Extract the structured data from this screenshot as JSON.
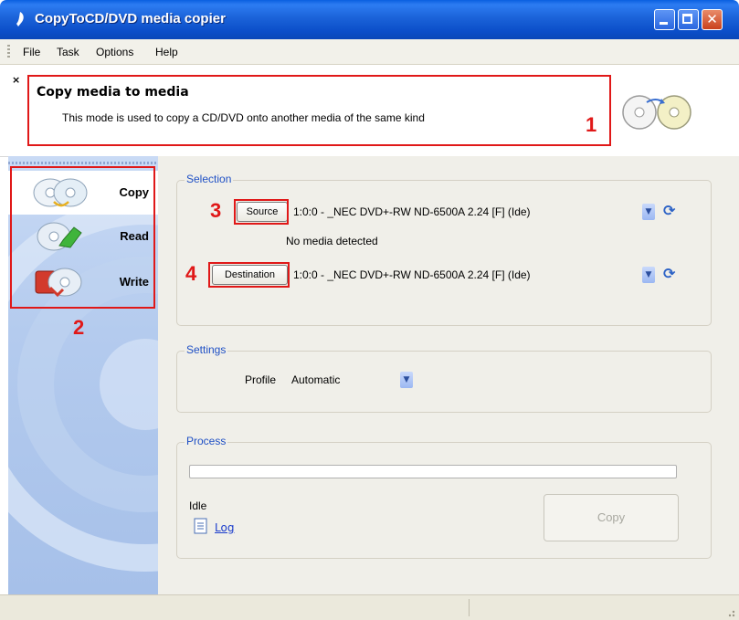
{
  "window": {
    "title": "CopyToCD/DVD media copier",
    "close_glyph": "✕"
  },
  "menu": {
    "items": [
      "File",
      "Task",
      "Options",
      "Help"
    ]
  },
  "banner": {
    "close_glyph": "×",
    "title": "Copy media to media",
    "description": "This mode is used to copy a CD/DVD onto another media of the same kind",
    "icon": "cd-copy-icon"
  },
  "annotations": [
    "1",
    "2",
    "3",
    "4"
  ],
  "sidebar": {
    "items": [
      {
        "label": "Copy",
        "icon": "copy-discs-icon",
        "selected": true
      },
      {
        "label": "Read",
        "icon": "read-disc-icon",
        "selected": false
      },
      {
        "label": "Write",
        "icon": "write-disc-icon",
        "selected": false
      }
    ]
  },
  "selection": {
    "title": "Selection",
    "source_label": "Source",
    "source_value": "1:0:0 - _NEC DVD+-RW ND-6500A 2.24 [F] (Ide)",
    "source_status": "No media detected",
    "destination_label": "Destination",
    "destination_value": "1:0:0 - _NEC DVD+-RW ND-6500A 2.24 [F] (Ide)"
  },
  "settings": {
    "title": "Settings",
    "profile_label": "Profile",
    "profile_value": "Automatic"
  },
  "process": {
    "title": "Process",
    "progress": 0,
    "status": "Idle",
    "log_label": "Log",
    "copy_button": "Copy"
  },
  "colors": {
    "annotation": "#e01818",
    "group_title": "#1f50c5",
    "titlebar": "#0b4ec9"
  }
}
